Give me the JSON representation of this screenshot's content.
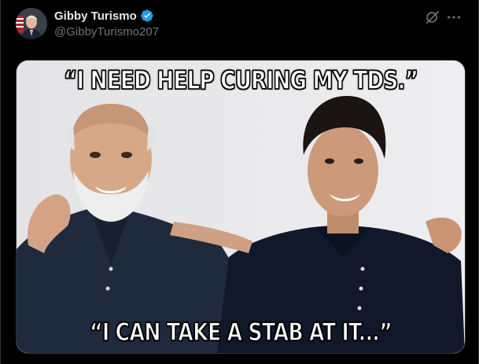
{
  "post": {
    "author_name": "Gibby Turismo",
    "author_handle": "@GibbyTurismo207",
    "verified": true
  },
  "meme": {
    "top_text": "“I NEED HELP CURING MY TDS.”",
    "bottom_text": "“I CAN TAKE A STAB AT IT...”"
  },
  "icons": {
    "verified": "verified-badge-icon",
    "grok": "grok-icon",
    "more": "more-options-icon"
  },
  "colors": {
    "background": "#000000",
    "text_primary": "#e7e9ea",
    "text_secondary": "#71767b",
    "verified_blue": "#1d9bf0",
    "border": "#2f3336"
  }
}
